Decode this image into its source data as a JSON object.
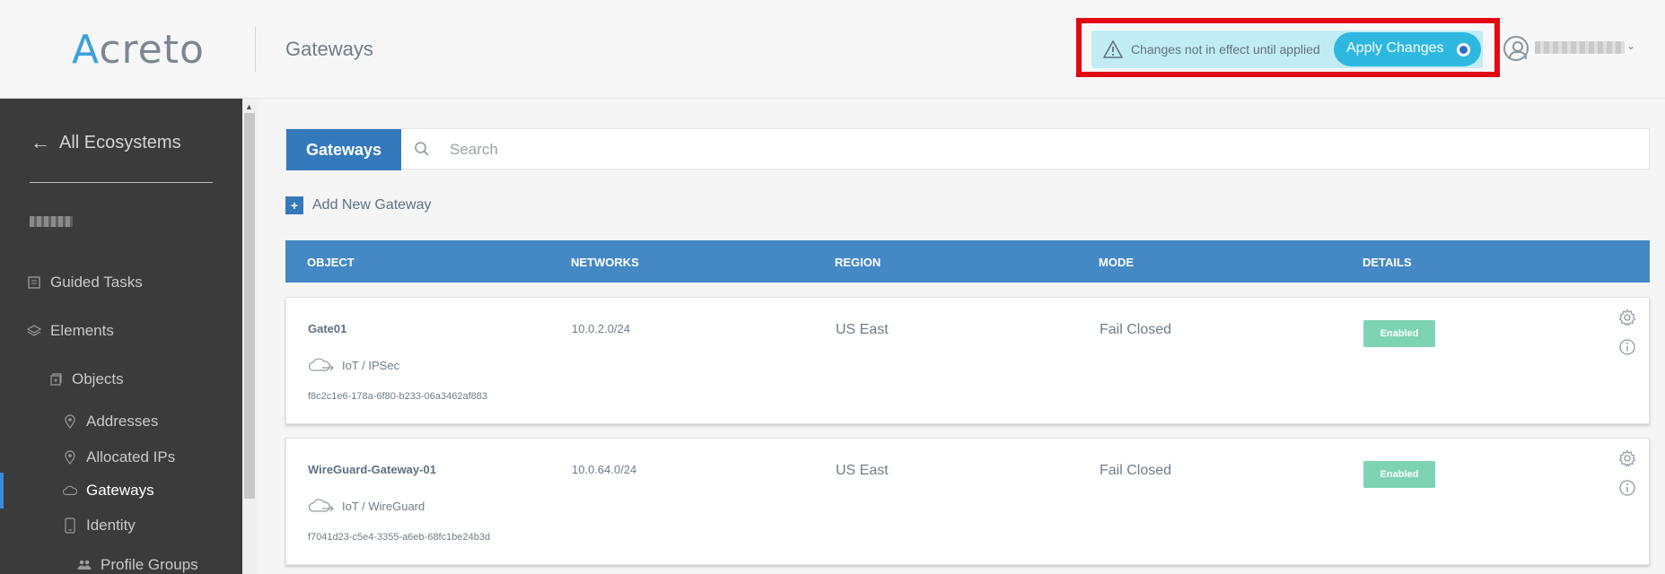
{
  "header": {
    "logo": "Acreto",
    "title": "Gateways",
    "changes_notice": "Changes not in effect until applied",
    "apply_label": "Apply Changes"
  },
  "sidebar": {
    "back_label": "All Ecosystems",
    "items": [
      {
        "label": "Guided Tasks",
        "icon": "document-list-icon"
      },
      {
        "label": "Elements",
        "icon": "layers-icon"
      },
      {
        "label": "Objects",
        "icon": "objects-icon"
      },
      {
        "label": "Addresses",
        "icon": "location-pin-icon"
      },
      {
        "label": "Allocated IPs",
        "icon": "location-pin-icon"
      },
      {
        "label": "Gateways",
        "icon": "cloud-icon"
      },
      {
        "label": "Identity",
        "icon": "phone-icon"
      },
      {
        "label": "Profile Groups",
        "icon": "people-icon"
      }
    ]
  },
  "main": {
    "tab_label": "Gateways",
    "search_placeholder": "Search",
    "add_label": "Add New Gateway",
    "columns": [
      "OBJECT",
      "NETWORKS",
      "REGION",
      "MODE",
      "DETAILS"
    ],
    "rows": [
      {
        "name": "Gate01",
        "type": "IoT / IPSec",
        "uuid": "f8c2c1e6-178a-6f80-b233-06a3462af883",
        "network": "10.0.2.0/24",
        "region": "US East",
        "mode": "Fail Closed",
        "status": "Enabled"
      },
      {
        "name": "WireGuard-Gateway-01",
        "type": "IoT / WireGuard",
        "uuid": "f7041d23-c5e4-3355-a6eb-68fc1be24b3d",
        "network": "10.0.64.0/24",
        "region": "US East",
        "mode": "Fail Closed",
        "status": "Enabled"
      }
    ]
  },
  "colors": {
    "accent": "#3579bd",
    "apply": "#2eb8e0",
    "enabled": "#7dd3b2",
    "highlight": "#e30613"
  }
}
